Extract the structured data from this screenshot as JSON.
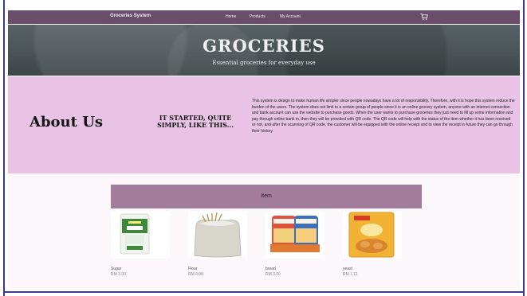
{
  "nav": {
    "brand": "Groceries System",
    "links": [
      "Home",
      "Products",
      "My Account"
    ],
    "cart_icon": "cart-icon",
    "background": "#6a4d6b"
  },
  "hero": {
    "title": "GROCERIES",
    "subtitle": "Essential groceries for everyday use"
  },
  "about": {
    "title": "About Us",
    "tagline": "IT STARTED, QUITE SIMPLY, LIKE THIS...",
    "text": "This system is design to make human life simpler since people nowadays have a lot of responsibility. Therefore, with it is hope this system reduce the burden of the users. The system does not limit to a certain group of people since it is an online grocery system, anyone with an internet connection and bank account can use the website to purchase goods. When the user wants to purchase groceries they just need to fill up some information and pay through online bank in, then they will be provided with QR code. The QR code will help with the status of the item whether it has been received or not, and after the scanning of QR code, the customer will be equipped with the online receipt and to view the receipt in future they can go through their history.",
    "background": "#e8c3e6"
  },
  "items": {
    "header": "Item",
    "bar_color": "#a27c9b",
    "products": [
      {
        "name": "Sugar",
        "price": "RM 3.00",
        "image": "sugar-bag-image"
      },
      {
        "name": "Flour",
        "price": "RM 4.00",
        "image": "flour-sack-image"
      },
      {
        "name": "bread",
        "price": "RM 3.00",
        "image": "bread-loaves-image"
      },
      {
        "name": "yeast",
        "price": "RM 1.11",
        "image": "yeast-packet-image"
      }
    ]
  }
}
